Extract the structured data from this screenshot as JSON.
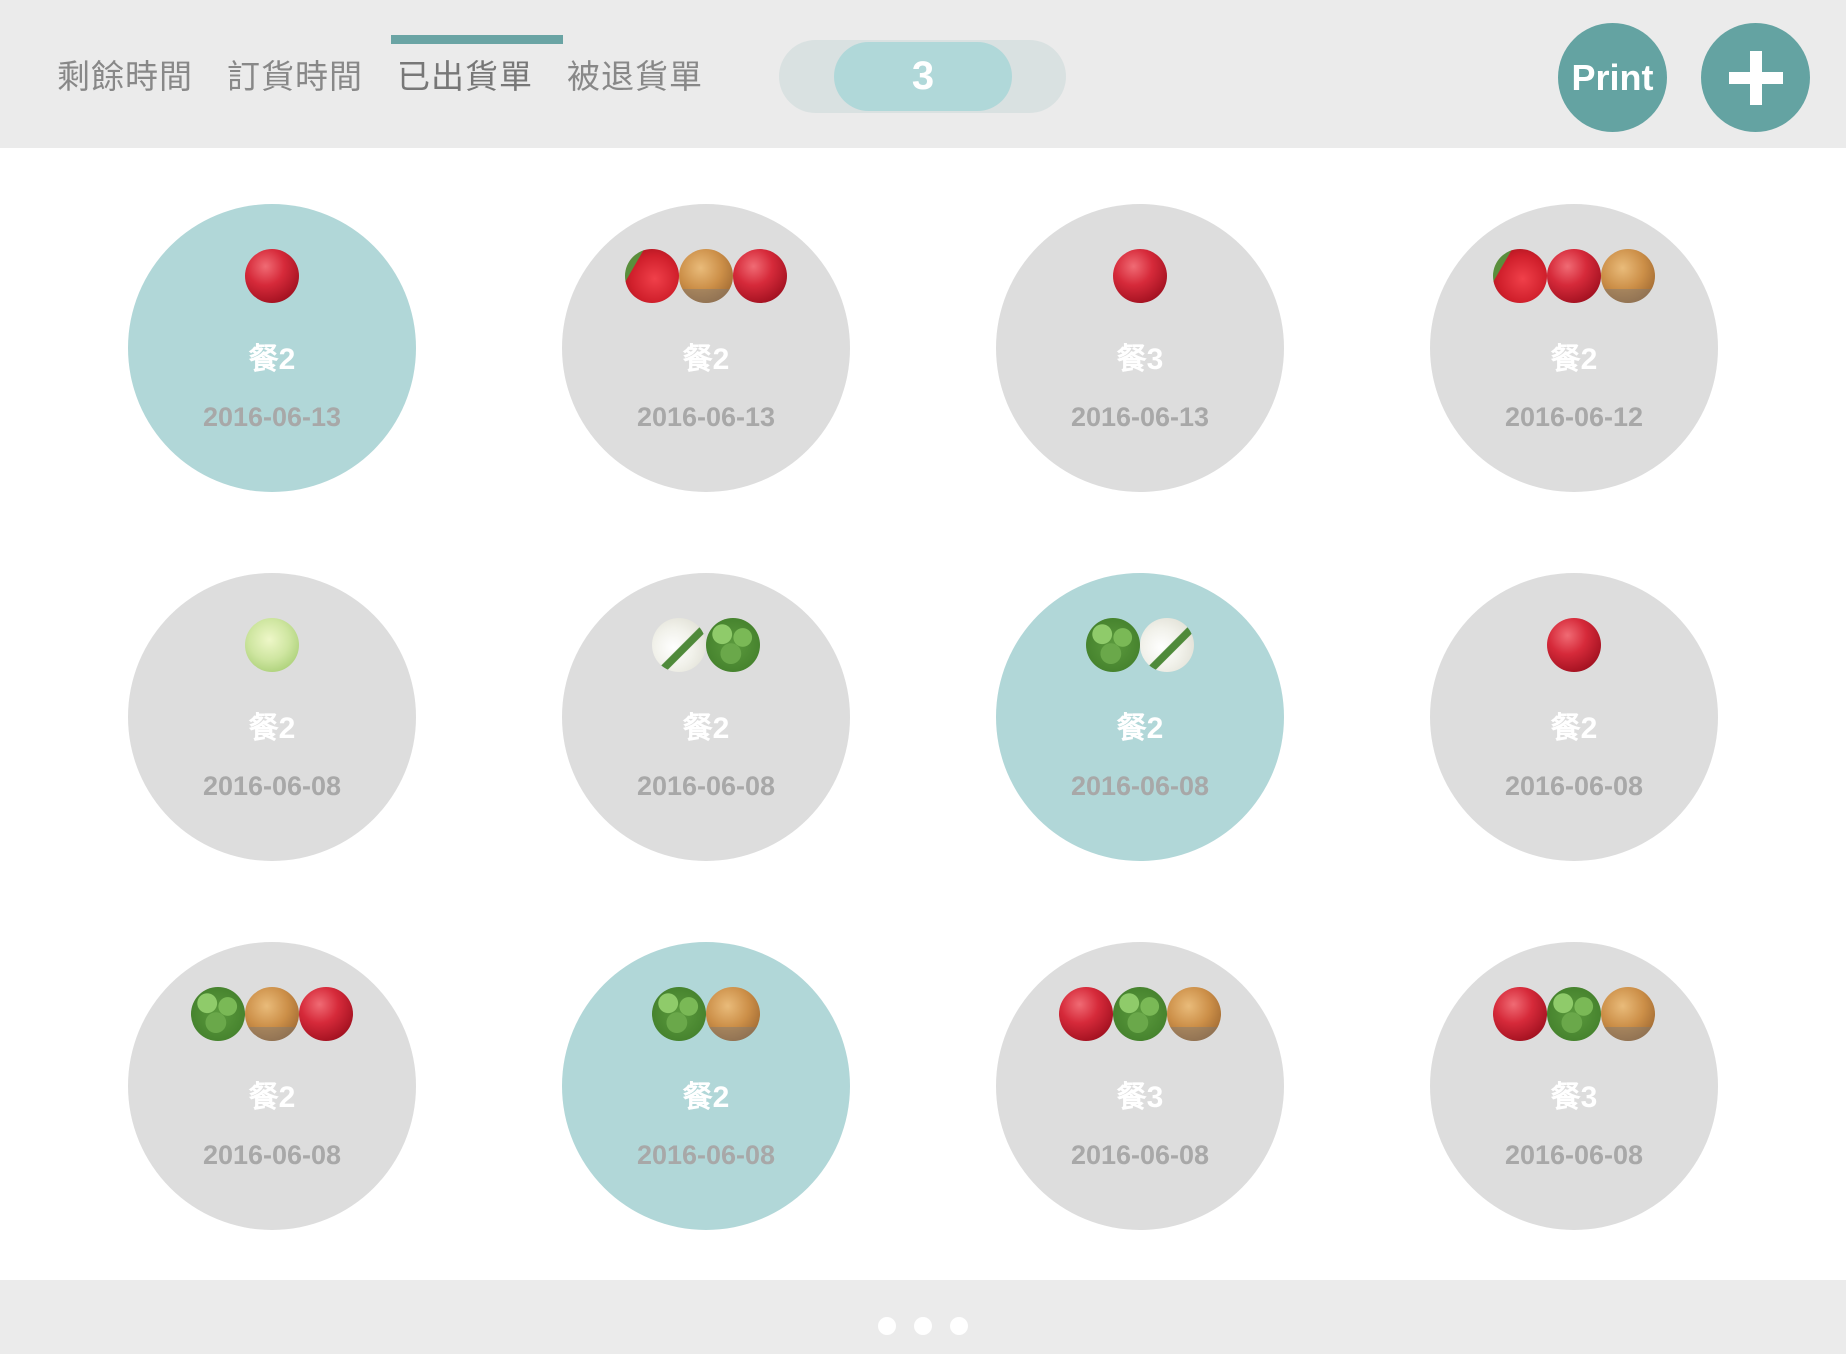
{
  "tabs": [
    {
      "label": "剩餘時間"
    },
    {
      "label": "訂貨時間"
    },
    {
      "label": "已出貨單"
    },
    {
      "label": "被退貨單"
    }
  ],
  "active_tab_index": 2,
  "counter": {
    "value": "3"
  },
  "buttons": {
    "print_label": "Print",
    "add_icon": "plus-icon"
  },
  "colors": {
    "accent": "#64a3a2",
    "selected_circle": "#b1d7d8",
    "circle": "#dddddd",
    "header_bg": "#ebebeb"
  },
  "orders": [
    {
      "meal": "餐2",
      "date": "2016-06-13",
      "selected": true,
      "items": [
        "apple"
      ]
    },
    {
      "meal": "餐2",
      "date": "2016-06-13",
      "selected": false,
      "items": [
        "red-pepper",
        "potato",
        "apple"
      ]
    },
    {
      "meal": "餐3",
      "date": "2016-06-13",
      "selected": false,
      "items": [
        "apple"
      ]
    },
    {
      "meal": "餐2",
      "date": "2016-06-12",
      "selected": false,
      "items": [
        "red-pepper",
        "apple",
        "potato"
      ]
    },
    {
      "meal": "餐2",
      "date": "2016-06-08",
      "selected": false,
      "items": [
        "cabbage"
      ]
    },
    {
      "meal": "餐2",
      "date": "2016-06-08",
      "selected": false,
      "items": [
        "radish",
        "broccoli"
      ]
    },
    {
      "meal": "餐2",
      "date": "2016-06-08",
      "selected": true,
      "items": [
        "broccoli",
        "radish"
      ]
    },
    {
      "meal": "餐2",
      "date": "2016-06-08",
      "selected": false,
      "items": [
        "apple"
      ]
    },
    {
      "meal": "餐2",
      "date": "2016-06-08",
      "selected": false,
      "items": [
        "broccoli",
        "potato",
        "apple"
      ]
    },
    {
      "meal": "餐2",
      "date": "2016-06-08",
      "selected": true,
      "items": [
        "broccoli",
        "potato"
      ]
    },
    {
      "meal": "餐3",
      "date": "2016-06-08",
      "selected": false,
      "items": [
        "apple",
        "broccoli",
        "potato"
      ]
    },
    {
      "meal": "餐3",
      "date": "2016-06-08",
      "selected": false,
      "items": [
        "apple",
        "broccoli",
        "potato"
      ]
    }
  ],
  "pagination": {
    "pages": 3
  }
}
